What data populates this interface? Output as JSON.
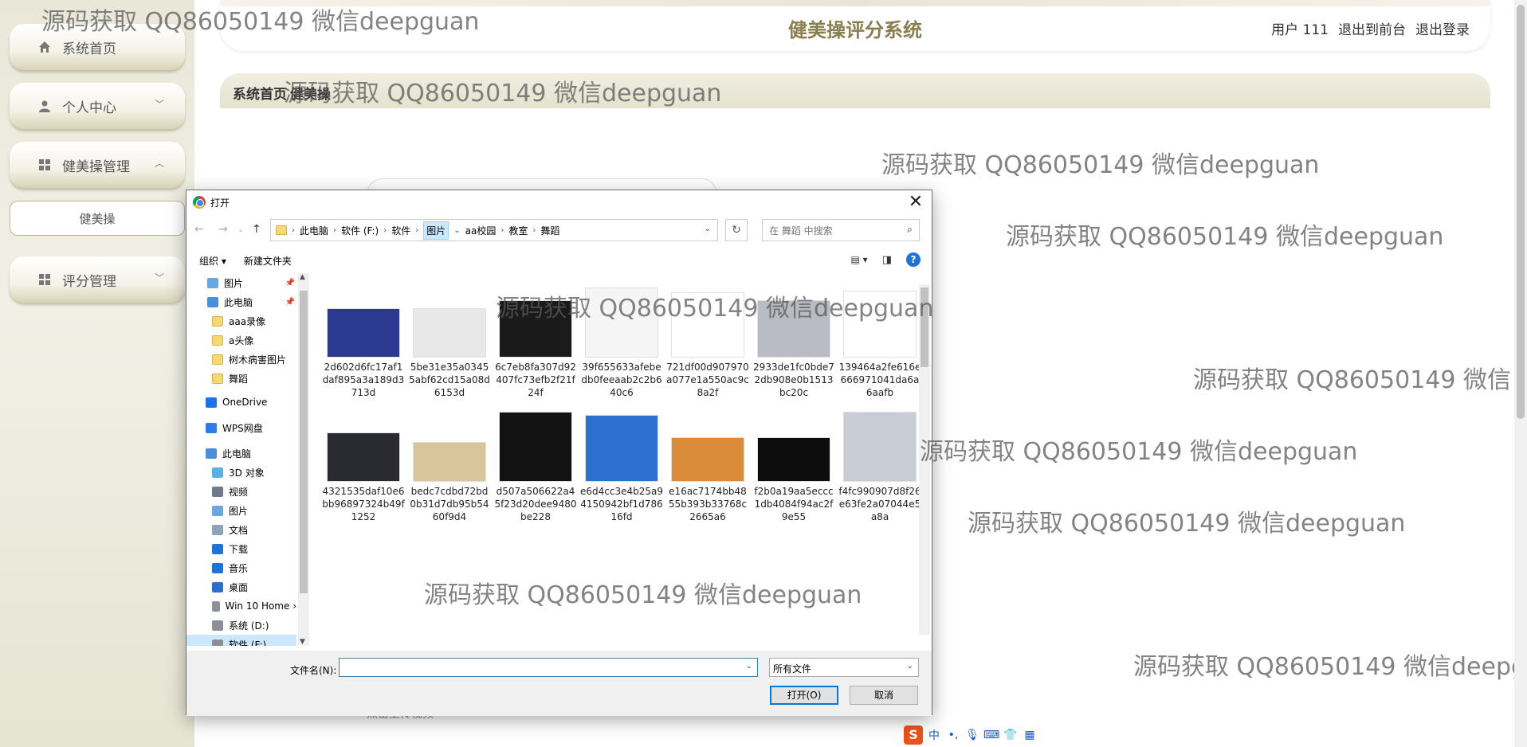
{
  "app": {
    "site_title": "健美操评分系统",
    "user_label": "用户 111",
    "back_label": "退出到前台",
    "logout_label": "退出登录"
  },
  "sidebar": {
    "items": [
      {
        "label": "系统首页",
        "icon": "home-icon"
      },
      {
        "label": "个人中心",
        "icon": "user-icon"
      },
      {
        "label": "健美操管理",
        "icon": "grid-icon"
      },
      {
        "label": "评分管理",
        "icon": "grid-icon"
      }
    ],
    "sub_item": "健美操"
  },
  "breadcrumb": {
    "home": "系统首页",
    "current": "健美操"
  },
  "page": {
    "hint_text": "点击上传视频"
  },
  "watermark": "源码获取 QQ86050149 微信deepguan",
  "dialog": {
    "title": "打开",
    "path": [
      "此电脑",
      "软件 (F:)",
      "软件",
      "图片",
      "aa校园",
      "教室",
      "舞蹈"
    ],
    "selected_crumb": "图片",
    "search_placeholder": "在 舞蹈 中搜索",
    "organize": "组织 ▾",
    "new_folder": "新建文件夹",
    "nav_items": [
      {
        "label": "图片",
        "icon": "pictures-icon",
        "pinned": true
      },
      {
        "label": "此电脑",
        "icon": "pc-icon",
        "pinned": true
      },
      {
        "label": "aaa录像",
        "icon": "folder-icon"
      },
      {
        "label": "a头像",
        "icon": "folder-icon"
      },
      {
        "label": "树木病害图片",
        "icon": "folder-icon"
      },
      {
        "label": "舞蹈",
        "icon": "folder-icon"
      },
      {
        "label": "OneDrive",
        "icon": "onedrive-icon"
      },
      {
        "label": "WPS网盘",
        "icon": "cloud-icon"
      },
      {
        "label": "此电脑",
        "icon": "pc-icon"
      },
      {
        "label": "3D 对象",
        "icon": "cube-icon"
      },
      {
        "label": "视频",
        "icon": "video-icon"
      },
      {
        "label": "图片",
        "icon": "pictures-icon"
      },
      {
        "label": "文档",
        "icon": "document-icon"
      },
      {
        "label": "下载",
        "icon": "download-icon"
      },
      {
        "label": "音乐",
        "icon": "music-icon"
      },
      {
        "label": "桌面",
        "icon": "desktop-icon"
      },
      {
        "label": "Win 10 Home ›",
        "icon": "drive-icon"
      },
      {
        "label": "系统 (D:)",
        "icon": "drive-icon"
      },
      {
        "label": "软件 (F:)",
        "icon": "drive-icon"
      }
    ],
    "files": [
      {
        "name": "2d602d6fc17af1daf895a3a189d3713d",
        "color": "#2b3a8f"
      },
      {
        "name": "5be31e35a03455abf62cd15a08d6153d",
        "color": "#e8e8e8"
      },
      {
        "name": "6c7eb8fa307d92407fc73efb2f21f24f",
        "color": "#1a1a1a"
      },
      {
        "name": "39f655633afebedb0feeaab2c2b640c6",
        "color": "#f5f5f5"
      },
      {
        "name": "721df00d907970a077e1a550ac9c8a2f",
        "color": "#ffffff"
      },
      {
        "name": "2933de1fc0bde72db908e0b1513bc20c",
        "color": "#b9bcc4"
      },
      {
        "name": "139464a2fe616e666971041da6a6aafb",
        "color": "#ffffff"
      },
      {
        "name": "4321535daf10e6bb96897324b49f1252",
        "color": "#2a2a33"
      },
      {
        "name": "bedc7cdbd72bd0b31d7db95b5460f9d4",
        "color": "#d9c59a"
      },
      {
        "name": "d507a506622a45f23d20dee9480be228",
        "color": "#121212"
      },
      {
        "name": "e6d4cc3e4b25a94150942bf1d78616fd",
        "color": "#2c6fd1"
      },
      {
        "name": "e16ac7174bb4855b393b33768c2665a6",
        "color": "#d98b3a"
      },
      {
        "name": "f2b0a19aa5eccc1db4084f94ac2f9e55",
        "color": "#0d0d0d"
      },
      {
        "name": "f4fc990907d8f26e63fe2a07044e5a8a",
        "color": "#c8ccd4"
      }
    ],
    "filename_label": "文件名(N):",
    "filename_value": "",
    "filetype_value": "所有文件",
    "open_button": "打开(O)",
    "cancel_button": "取消"
  },
  "ime": {
    "s": "S",
    "mode": "中"
  }
}
